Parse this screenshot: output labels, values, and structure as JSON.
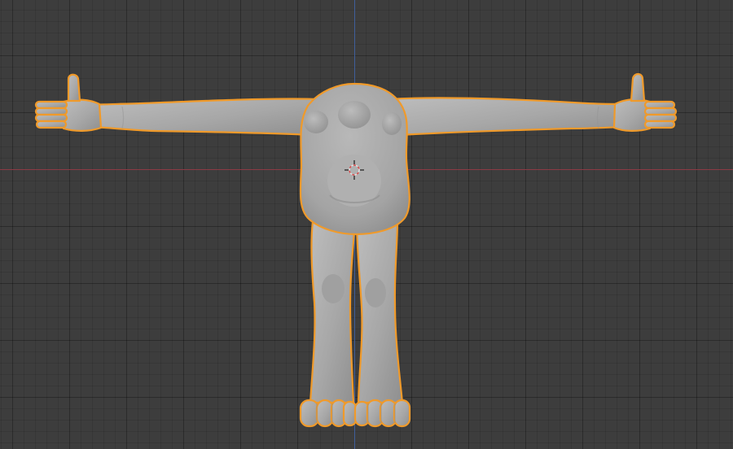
{
  "viewport": {
    "background_color": "#3d3d3d",
    "grid_color": "#2e2e2e",
    "axis_x_color": "#8c3a44",
    "axis_y_color": "#3f5f9b"
  },
  "object": {
    "type": "mesh",
    "selected": true,
    "outline_color": "#f09a2a",
    "surface_color": "#a9a9a9",
    "shape": "humanoid-t-pose"
  },
  "cursor_3d": {
    "icon": "3d-cursor-icon",
    "colors": [
      "#e0e0e0",
      "#d94c4c"
    ]
  }
}
